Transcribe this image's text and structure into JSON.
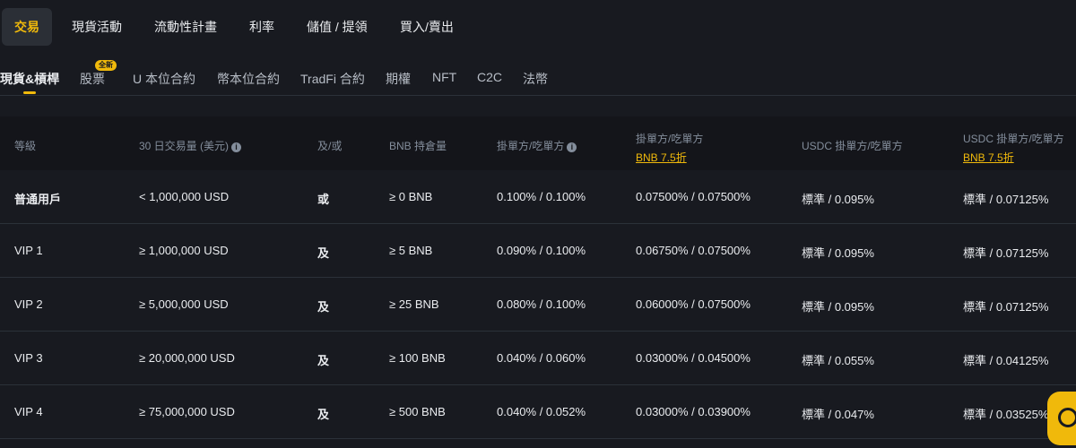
{
  "top_tabs": [
    {
      "label": "交易",
      "active": true
    },
    {
      "label": "現貨活動",
      "active": false
    },
    {
      "label": "流動性計畫",
      "active": false
    },
    {
      "label": "利率",
      "active": false
    },
    {
      "label": "儲值 / 提領",
      "active": false
    },
    {
      "label": "買入/賣出",
      "active": false
    }
  ],
  "sub_tabs": [
    {
      "label": "現貨&槓桿",
      "active": true
    },
    {
      "label": "股票",
      "active": false
    },
    {
      "label": "U 本位合約",
      "active": false
    },
    {
      "label": "幣本位合約",
      "active": false
    },
    {
      "label": "TradFi 合約",
      "active": false
    },
    {
      "label": "期權",
      "active": false
    },
    {
      "label": "NFT",
      "active": false
    },
    {
      "label": "C2C",
      "active": false
    },
    {
      "label": "法幣",
      "active": false
    }
  ],
  "new_badge": "全新",
  "table": {
    "headers": {
      "level": "等級",
      "volume": "30 日交易量 (美元)",
      "and_or": "及/或",
      "bnb_holding": "BNB 持倉量",
      "maker_taker": "掛單方/吃單方",
      "maker_taker_bnb": "掛單方/吃單方",
      "maker_taker_bnb_link": "BNB 7.5折",
      "usdc_maker_taker": "USDC 掛單方/吃單方",
      "usdc_maker_taker_bnb": "USDC 掛單方/吃單方",
      "usdc_maker_taker_bnb_link": "BNB 7.5折"
    },
    "rows": [
      {
        "level": "普通用戶",
        "volume": "< 1,000,000 USD",
        "and_or": "或",
        "bnb": "≥ 0 BNB",
        "mt": "0.100% / 0.100%",
        "mt_bnb": "0.07500% / 0.07500%",
        "usdc": "標準 / 0.095%",
        "usdc_bnb": "標準 / 0.07125%"
      },
      {
        "level": "VIP 1",
        "volume": "≥ 1,000,000 USD",
        "and_or": "及",
        "bnb": "≥ 5 BNB",
        "mt": "0.090% / 0.100%",
        "mt_bnb": "0.06750% / 0.07500%",
        "usdc": "標準 / 0.095%",
        "usdc_bnb": "標準 / 0.07125%"
      },
      {
        "level": "VIP 2",
        "volume": "≥ 5,000,000 USD",
        "and_or": "及",
        "bnb": "≥ 25 BNB",
        "mt": "0.080% / 0.100%",
        "mt_bnb": "0.06000% / 0.07500%",
        "usdc": "標準 / 0.095%",
        "usdc_bnb": "標準 / 0.07125%"
      },
      {
        "level": "VIP 3",
        "volume": "≥ 20,000,000 USD",
        "and_or": "及",
        "bnb": "≥ 100 BNB",
        "mt": "0.040% / 0.060%",
        "mt_bnb": "0.03000% / 0.04500%",
        "usdc": "標準 / 0.055%",
        "usdc_bnb": "標準 / 0.04125%"
      },
      {
        "level": "VIP 4",
        "volume": "≥ 75,000,000 USD",
        "and_or": "及",
        "bnb": "≥ 500 BNB",
        "mt": "0.040% / 0.052%",
        "mt_bnb": "0.03000% / 0.03900%",
        "usdc": "標準 / 0.047%",
        "usdc_bnb": "標準 / 0.03525%"
      }
    ]
  },
  "colors": {
    "accent": "#f0b90b",
    "background": "#181a20",
    "header_bg": "#14151a",
    "muted_text": "#848e9c"
  },
  "icons": {
    "info": "info-icon",
    "support": "headset-icon"
  }
}
